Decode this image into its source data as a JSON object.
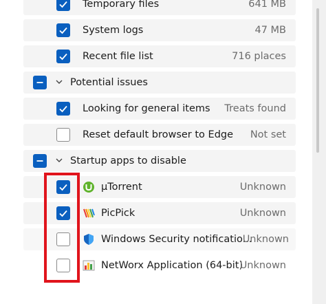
{
  "items": [
    {
      "label": "Temporary files",
      "value": "641 MB",
      "state": "checked"
    },
    {
      "label": "System logs",
      "value": "47 MB",
      "state": "checked"
    },
    {
      "label": "Recent file list",
      "value": "716 places",
      "state": "checked"
    },
    {
      "label": "Looking for general items",
      "value": "Treats found",
      "state": "checked"
    },
    {
      "label": "Reset default browser to Edge",
      "value": "Not set",
      "state": "unchecked"
    }
  ],
  "groups": [
    {
      "label": "Potential issues",
      "state": "indeterminate",
      "expanded": true
    },
    {
      "label": "Startup apps to disable",
      "state": "indeterminate",
      "expanded": true
    }
  ],
  "startup_apps": [
    {
      "label": "µTorrent",
      "value": "Unknown",
      "state": "checked",
      "icon": "utorrent-icon"
    },
    {
      "label": "PicPick",
      "value": "Unknown",
      "state": "checked",
      "icon": "picpick-icon"
    },
    {
      "label": "Windows Security notificatio...",
      "value": "Unknown",
      "state": "unchecked",
      "icon": "windows-security-shield-icon"
    },
    {
      "label": "NetWorx Application (64-bit)",
      "value": "Unknown",
      "state": "unchecked",
      "icon": "networx-icon"
    }
  ],
  "colors": {
    "accent": "#0a5fbf",
    "highlight": "#e0141c"
  }
}
